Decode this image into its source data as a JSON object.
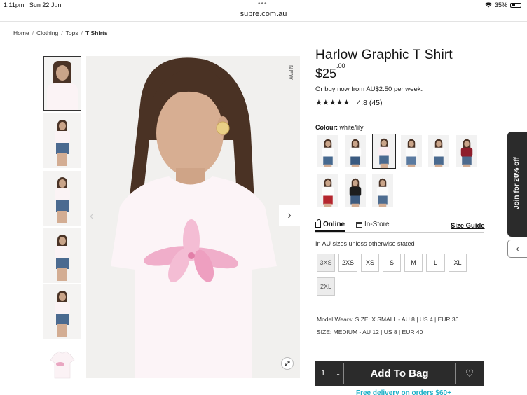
{
  "status": {
    "time": "1:11pm",
    "date": "Sun 22 Jun",
    "battery": "35%"
  },
  "url": "supre.com.au",
  "breadcrumb": [
    "Home",
    "Clothing",
    "Tops",
    "T Shirts"
  ],
  "product": {
    "badge": "NEW",
    "title": "Harlow Graphic T Shirt",
    "price_main": "$25",
    "price_cents": ".00",
    "afterpay": "Or buy now from AU$2.50 per week.",
    "stars": "★★★★★",
    "rating": "4.8",
    "reviews": "(45)",
    "colour_label": "Colour:",
    "colour_value": "white/lily",
    "swatch_count": 9,
    "selected_swatch": 3
  },
  "tabs": {
    "online": "Online",
    "instore": "In-Store",
    "size_guide": "Size Guide"
  },
  "sizes_note": "In AU sizes unless otherwise stated",
  "sizes": [
    {
      "label": "3XS",
      "out_of_stock": true
    },
    {
      "label": "2XS",
      "out_of_stock": false
    },
    {
      "label": "XS",
      "out_of_stock": false
    },
    {
      "label": "S",
      "out_of_stock": false
    },
    {
      "label": "M",
      "out_of_stock": false
    },
    {
      "label": "L",
      "out_of_stock": false
    },
    {
      "label": "XL",
      "out_of_stock": false
    },
    {
      "label": "2XL",
      "out_of_stock": true
    }
  ],
  "model": {
    "line1": "Model Wears: SIZE: X SMALL - AU 8 | US 4 | EUR 36",
    "line2": "SIZE: MEDIUM - AU 12 | US 8 | EUR 40"
  },
  "cart": {
    "qty": "1",
    "add_label": "Add To Bag",
    "delivery": "Free delivery on orders $60+"
  },
  "promo": {
    "join": "Join for 20% off"
  },
  "colors": {
    "accent": "#1bb0c7",
    "button_bg": "#2b2b2b"
  },
  "icons": {
    "wishlist": "♡",
    "chevron_down": "⌄",
    "chevron_left": "‹",
    "arrow_right": "›",
    "zoom": "expand-icon"
  }
}
